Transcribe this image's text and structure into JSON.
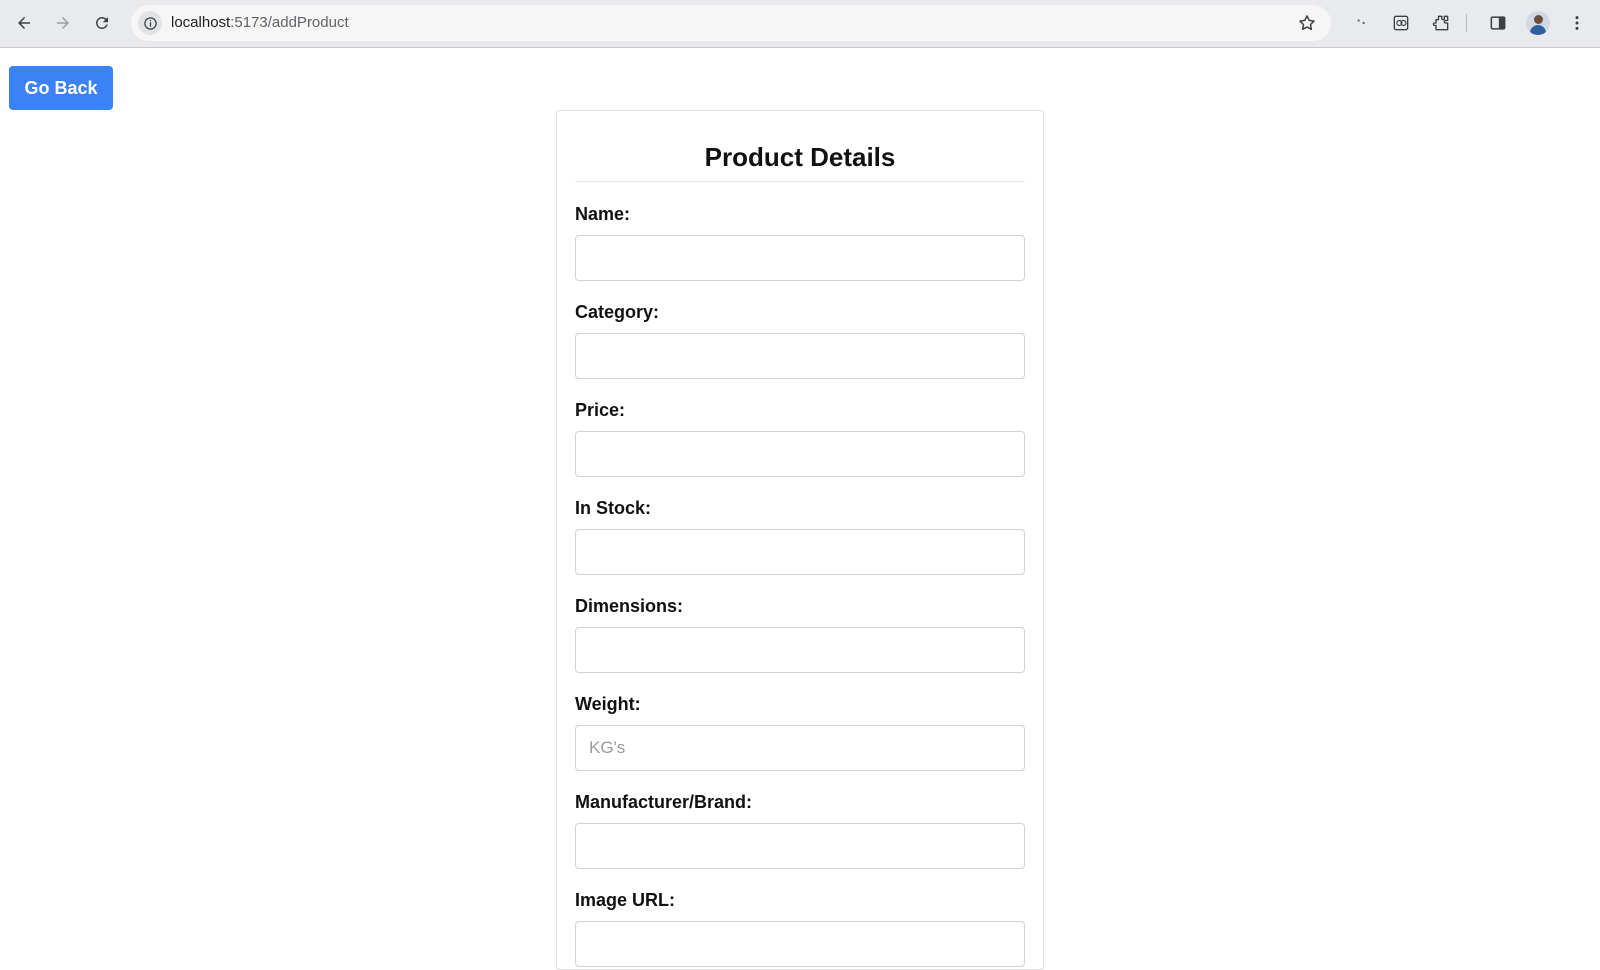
{
  "browser": {
    "url_host": "localhost",
    "url_path": ":5173/addProduct"
  },
  "page": {
    "go_back_label": "Go Back",
    "title": "Product Details"
  },
  "fields": [
    {
      "label": "Name:",
      "value": "",
      "placeholder": ""
    },
    {
      "label": "Category:",
      "value": "",
      "placeholder": ""
    },
    {
      "label": "Price:",
      "value": "",
      "placeholder": ""
    },
    {
      "label": "In Stock:",
      "value": "",
      "placeholder": ""
    },
    {
      "label": "Dimensions:",
      "value": "",
      "placeholder": ""
    },
    {
      "label": "Weight:",
      "value": "",
      "placeholder": "KG's"
    },
    {
      "label": "Manufacturer/Brand:",
      "value": "",
      "placeholder": ""
    },
    {
      "label": "Image URL:",
      "value": "",
      "placeholder": ""
    }
  ],
  "colors": {
    "accent": "#3b82f6",
    "chrome_bg": "#e8eaed"
  }
}
